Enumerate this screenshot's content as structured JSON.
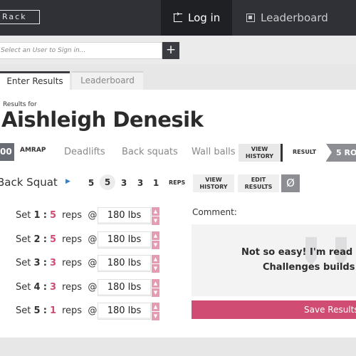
{
  "app": {
    "logo": "Rack"
  },
  "nav": {
    "login": "Log in",
    "leaderboard": "Leaderboard"
  },
  "user_select": {
    "placeholder": "Select an User to Sign in...",
    "add": "+"
  },
  "tabs": [
    {
      "label": "Enter Results",
      "active": true
    },
    {
      "label": "Leaderboard",
      "active": false
    }
  ],
  "results": {
    "caption": "Results for",
    "athlete": "Aishleigh Denesik"
  },
  "wod": {
    "score": "00",
    "type": "AMRAP",
    "movements": [
      "Deadlifts",
      "Back squats",
      "Wall balls"
    ],
    "view_history": [
      "VIEW",
      "HISTORY"
    ],
    "result_label": "RESULT",
    "result_value": "5 RO"
  },
  "exercise": {
    "name": "Back Squat",
    "reps": [
      "5",
      "5",
      "3",
      "3",
      "1"
    ],
    "selected_rep_index": 1,
    "reps_label": "REPS",
    "view_history": [
      "VIEW",
      "HISTORY"
    ],
    "edit_results": [
      "EDIT",
      "RESULTS"
    ],
    "clear_icon": "Ø"
  },
  "sets": [
    {
      "label": "Set",
      "num": "1",
      "target": "5",
      "reps": "reps",
      "at": "@",
      "weight": "180 lbs"
    },
    {
      "label": "Set",
      "num": "2",
      "target": "5",
      "reps": "reps",
      "at": "@",
      "weight": "180 lbs"
    },
    {
      "label": "Set",
      "num": "3",
      "target": "3",
      "reps": "reps",
      "at": "@",
      "weight": "180 lbs"
    },
    {
      "label": "Set",
      "num": "4",
      "target": "3",
      "reps": "reps",
      "at": "@",
      "weight": "180 lbs"
    },
    {
      "label": "Set",
      "num": "5",
      "target": "1",
      "reps": "reps",
      "at": "@",
      "weight": "180 lbs"
    }
  ],
  "stepper": {
    "up": "▲",
    "down": "▼"
  },
  "comment": {
    "label": "Comment:",
    "line1": "Not so easy! I'm read",
    "line2": "Challenges builds"
  },
  "save": {
    "label": "Save Results"
  },
  "colors": {
    "accent": "#d04c72",
    "dark": "#2f3137",
    "stepper": "#e59bb2"
  }
}
